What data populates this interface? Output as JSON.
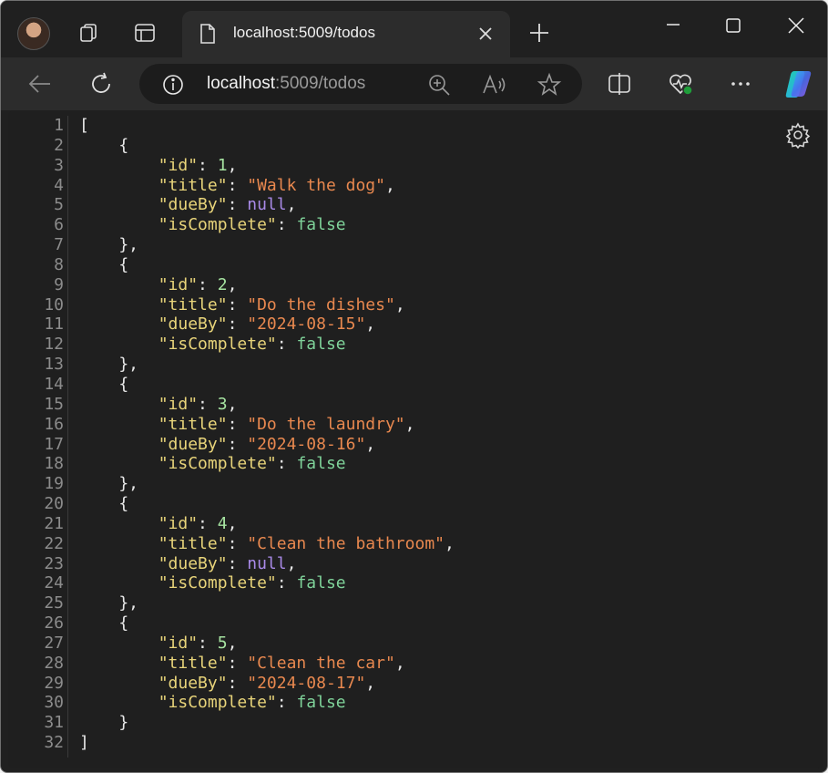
{
  "tab": {
    "title": "localhost:5009/todos"
  },
  "address": {
    "host": "localhost",
    "path": ":5009/todos"
  },
  "json_lines": [
    [
      {
        "t": "p",
        "v": "["
      }
    ],
    [
      {
        "t": "p",
        "v": "    {"
      }
    ],
    [
      {
        "t": "k",
        "v": "        \"id\""
      },
      {
        "t": "p",
        "v": ": "
      },
      {
        "t": "n",
        "v": "1"
      },
      {
        "t": "p",
        "v": ","
      }
    ],
    [
      {
        "t": "k",
        "v": "        \"title\""
      },
      {
        "t": "p",
        "v": ": "
      },
      {
        "t": "s",
        "v": "\"Walk the dog\""
      },
      {
        "t": "p",
        "v": ","
      }
    ],
    [
      {
        "t": "k",
        "v": "        \"dueBy\""
      },
      {
        "t": "p",
        "v": ": "
      },
      {
        "t": "nl",
        "v": "null"
      },
      {
        "t": "p",
        "v": ","
      }
    ],
    [
      {
        "t": "k",
        "v": "        \"isComplete\""
      },
      {
        "t": "p",
        "v": ": "
      },
      {
        "t": "b",
        "v": "false"
      }
    ],
    [
      {
        "t": "p",
        "v": "    },"
      }
    ],
    [
      {
        "t": "p",
        "v": "    {"
      }
    ],
    [
      {
        "t": "k",
        "v": "        \"id\""
      },
      {
        "t": "p",
        "v": ": "
      },
      {
        "t": "n",
        "v": "2"
      },
      {
        "t": "p",
        "v": ","
      }
    ],
    [
      {
        "t": "k",
        "v": "        \"title\""
      },
      {
        "t": "p",
        "v": ": "
      },
      {
        "t": "s",
        "v": "\"Do the dishes\""
      },
      {
        "t": "p",
        "v": ","
      }
    ],
    [
      {
        "t": "k",
        "v": "        \"dueBy\""
      },
      {
        "t": "p",
        "v": ": "
      },
      {
        "t": "s",
        "v": "\"2024-08-15\""
      },
      {
        "t": "p",
        "v": ","
      }
    ],
    [
      {
        "t": "k",
        "v": "        \"isComplete\""
      },
      {
        "t": "p",
        "v": ": "
      },
      {
        "t": "b",
        "v": "false"
      }
    ],
    [
      {
        "t": "p",
        "v": "    },"
      }
    ],
    [
      {
        "t": "p",
        "v": "    {"
      }
    ],
    [
      {
        "t": "k",
        "v": "        \"id\""
      },
      {
        "t": "p",
        "v": ": "
      },
      {
        "t": "n",
        "v": "3"
      },
      {
        "t": "p",
        "v": ","
      }
    ],
    [
      {
        "t": "k",
        "v": "        \"title\""
      },
      {
        "t": "p",
        "v": ": "
      },
      {
        "t": "s",
        "v": "\"Do the laundry\""
      },
      {
        "t": "p",
        "v": ","
      }
    ],
    [
      {
        "t": "k",
        "v": "        \"dueBy\""
      },
      {
        "t": "p",
        "v": ": "
      },
      {
        "t": "s",
        "v": "\"2024-08-16\""
      },
      {
        "t": "p",
        "v": ","
      }
    ],
    [
      {
        "t": "k",
        "v": "        \"isComplete\""
      },
      {
        "t": "p",
        "v": ": "
      },
      {
        "t": "b",
        "v": "false"
      }
    ],
    [
      {
        "t": "p",
        "v": "    },"
      }
    ],
    [
      {
        "t": "p",
        "v": "    {"
      }
    ],
    [
      {
        "t": "k",
        "v": "        \"id\""
      },
      {
        "t": "p",
        "v": ": "
      },
      {
        "t": "n",
        "v": "4"
      },
      {
        "t": "p",
        "v": ","
      }
    ],
    [
      {
        "t": "k",
        "v": "        \"title\""
      },
      {
        "t": "p",
        "v": ": "
      },
      {
        "t": "s",
        "v": "\"Clean the bathroom\""
      },
      {
        "t": "p",
        "v": ","
      }
    ],
    [
      {
        "t": "k",
        "v": "        \"dueBy\""
      },
      {
        "t": "p",
        "v": ": "
      },
      {
        "t": "nl",
        "v": "null"
      },
      {
        "t": "p",
        "v": ","
      }
    ],
    [
      {
        "t": "k",
        "v": "        \"isComplete\""
      },
      {
        "t": "p",
        "v": ": "
      },
      {
        "t": "b",
        "v": "false"
      }
    ],
    [
      {
        "t": "p",
        "v": "    },"
      }
    ],
    [
      {
        "t": "p",
        "v": "    {"
      }
    ],
    [
      {
        "t": "k",
        "v": "        \"id\""
      },
      {
        "t": "p",
        "v": ": "
      },
      {
        "t": "n",
        "v": "5"
      },
      {
        "t": "p",
        "v": ","
      }
    ],
    [
      {
        "t": "k",
        "v": "        \"title\""
      },
      {
        "t": "p",
        "v": ": "
      },
      {
        "t": "s",
        "v": "\"Clean the car\""
      },
      {
        "t": "p",
        "v": ","
      }
    ],
    [
      {
        "t": "k",
        "v": "        \"dueBy\""
      },
      {
        "t": "p",
        "v": ": "
      },
      {
        "t": "s",
        "v": "\"2024-08-17\""
      },
      {
        "t": "p",
        "v": ","
      }
    ],
    [
      {
        "t": "k",
        "v": "        \"isComplete\""
      },
      {
        "t": "p",
        "v": ": "
      },
      {
        "t": "b",
        "v": "false"
      }
    ],
    [
      {
        "t": "p",
        "v": "    }"
      }
    ],
    [
      {
        "t": "p",
        "v": "]"
      }
    ]
  ],
  "colors": {
    "key": "#e8d47a",
    "string": "#e8884f",
    "number": "#a6e3a1",
    "null": "#a98ae8",
    "boolean": "#7fd39a",
    "window_bg": "#202020",
    "toolbar_bg": "#2c2c2c"
  },
  "icons": {
    "titlebar": [
      "profile-avatar",
      "workspaces-icon",
      "tab-actions-icon",
      "page-icon",
      "close-icon",
      "new-tab-icon",
      "minimize-icon",
      "maximize-icon",
      "close-window-icon"
    ],
    "toolbar": [
      "back-icon",
      "refresh-icon",
      "info-icon",
      "zoom-icon",
      "read-aloud-icon",
      "favorite-star-icon",
      "split-screen-icon",
      "browser-essentials-icon",
      "more-icon",
      "copilot-icon"
    ],
    "viewer": [
      "settings-gear-icon"
    ]
  }
}
